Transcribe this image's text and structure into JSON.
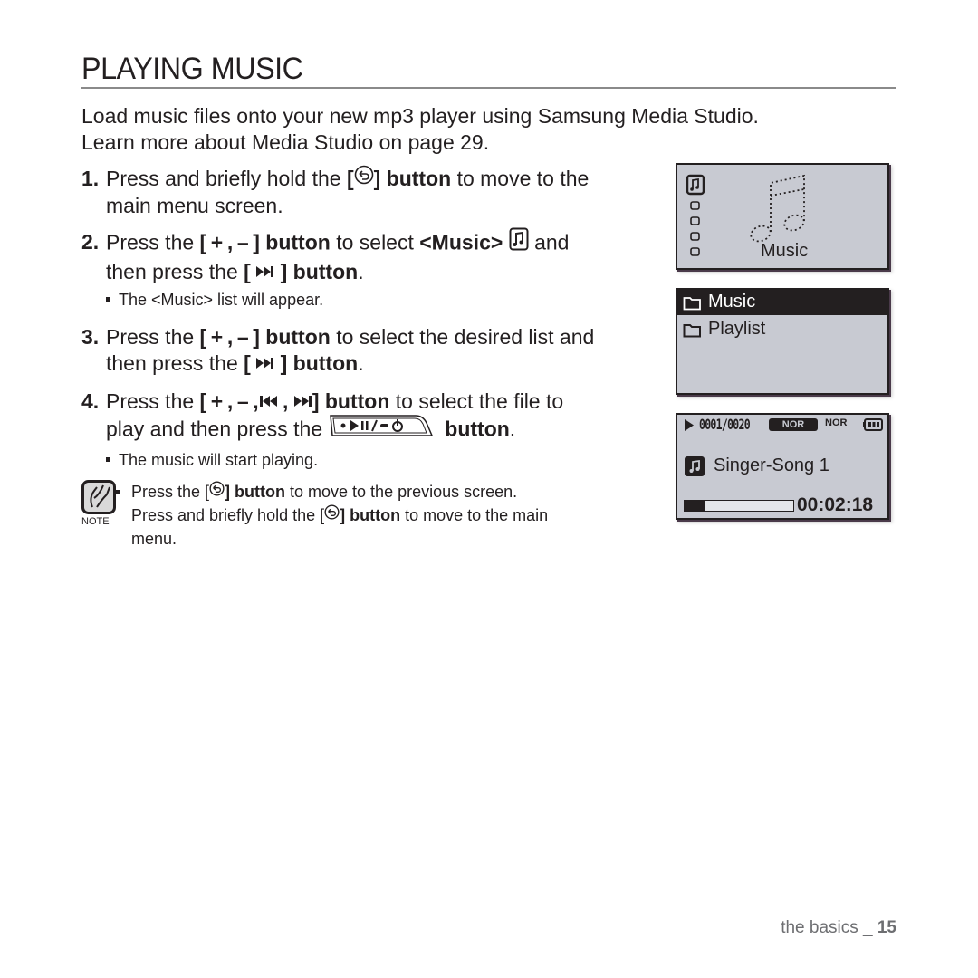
{
  "page": {
    "title": "PLAYING MUSIC",
    "intro_line1": "Load music files onto your new mp3 player using Samsung Media Studio.",
    "intro_line2": "Learn more about Media Studio on page 29."
  },
  "steps": [
    {
      "number": "1.",
      "parts": {
        "a": "Press and briefly hold the ",
        "b_open": "[",
        "b_close": "] button",
        "c": " to move to the",
        "d": "main menu screen."
      },
      "icons": [
        "back-button-icon"
      ]
    },
    {
      "number": "2.",
      "parts": {
        "a": "Press the ",
        "btn1": "[ + , – ] button",
        "b": " to select ",
        "music": "<Music>",
        "c": " and",
        "d": "then press the ",
        "btn2_open": "[ ",
        "btn2_close": " ] button",
        "e": "."
      },
      "subnote": "The <Music> list will appear.",
      "icons": [
        "music-menu-icon",
        "next-track-icon"
      ]
    },
    {
      "number": "3.",
      "parts": {
        "a": "Press the ",
        "btn1": "[ + , – ] button",
        "b": " to select the desired list and",
        "d": "then press the ",
        "btn2_open": "[ ",
        "btn2_close": " ] button",
        "e": "."
      },
      "icons": [
        "next-track-icon"
      ]
    },
    {
      "number": "4.",
      "parts": {
        "a": "Press the ",
        "btn1_open": "[ + , – ,",
        "comma": " ,",
        "btn1_close": "] button",
        "b": " to select the file to",
        "d": "play and then press the ",
        "e": " button",
        "f": "."
      },
      "subnote": "The music will start playing.",
      "icons": [
        "previous-track-icon",
        "next-track-icon",
        "play-pause-power-button-icon"
      ]
    }
  ],
  "note": {
    "label": "NOTE",
    "line1_a": "Press the [",
    "line1_b": "] button",
    "line1_c": " to move to the previous screen.",
    "line2_a": "Press and briefly hold the [",
    "line2_b": "] button",
    "line2_c": " to move to the main",
    "line3": "menu."
  },
  "screens": {
    "main_menu": {
      "label": "Music",
      "menu_icons": [
        "music-icon",
        "menu-dot",
        "menu-dot",
        "menu-dot",
        "menu-dot"
      ]
    },
    "music_list": {
      "items": [
        {
          "label": "Music",
          "selected": true
        },
        {
          "label": "Playlist",
          "selected": false
        }
      ]
    },
    "now_playing": {
      "track_counter": "0001/0020",
      "eq_mode": "NOR",
      "play_mode": "NOR",
      "song_title": "Singer-Song 1",
      "elapsed_time": "00:02:18",
      "progress_percent": 19
    }
  },
  "footer": {
    "section": "the basics _ ",
    "page_number": "15"
  },
  "colors": {
    "lcd_background": "#c8cad2",
    "lcd_dark": "#231f20",
    "footer_text": "#6d6e71",
    "rule": "#8a8a8a"
  }
}
